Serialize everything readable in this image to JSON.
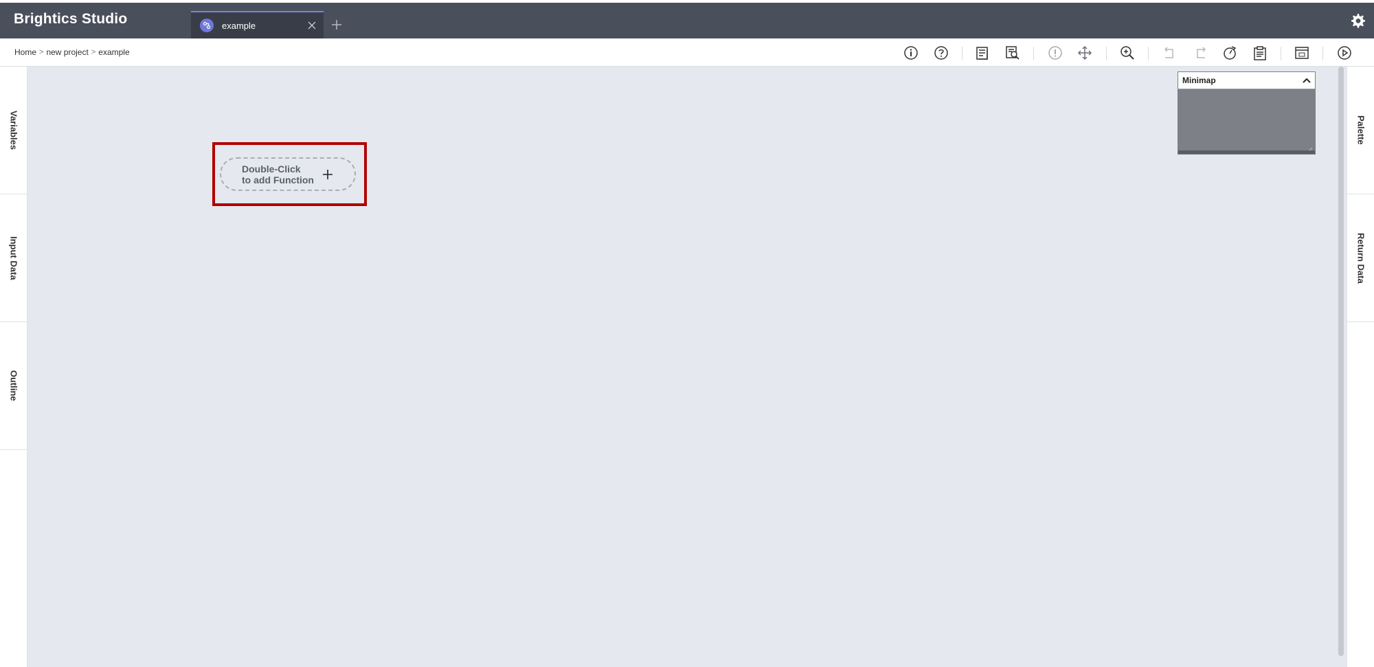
{
  "app": {
    "brand": "Brightics Studio",
    "settings_icon": "gear-icon"
  },
  "tabs": [
    {
      "label": "example",
      "icon": "model-icon",
      "active": true
    }
  ],
  "breadcrumb": [
    {
      "label": "Home"
    },
    {
      "label": "new project"
    },
    {
      "label": "example"
    }
  ],
  "toolbar": {
    "icons": [
      "info-icon",
      "help-icon",
      "checklist-icon",
      "report-icon",
      "warning-icon",
      "move-icon",
      "zoom-icon",
      "undo-icon",
      "redo-icon",
      "history-icon",
      "clipboard-icon",
      "calendar-icon",
      "run-icon"
    ]
  },
  "left_panels": [
    {
      "label": "Variables"
    },
    {
      "label": "Input Data"
    },
    {
      "label": "Outline"
    }
  ],
  "right_panels": [
    {
      "label": "Palette"
    },
    {
      "label": "Return Data"
    }
  ],
  "canvas": {
    "add_function": {
      "line1": "Double-Click",
      "line2": "to add Function"
    }
  },
  "minimap": {
    "title": "Minimap"
  },
  "colors": {
    "topbar": "#4a4f5c",
    "tab_active": "#393d48",
    "tab_accent": "#7b83e0",
    "canvas": "#e5e8ee",
    "highlight": "#b00000"
  }
}
